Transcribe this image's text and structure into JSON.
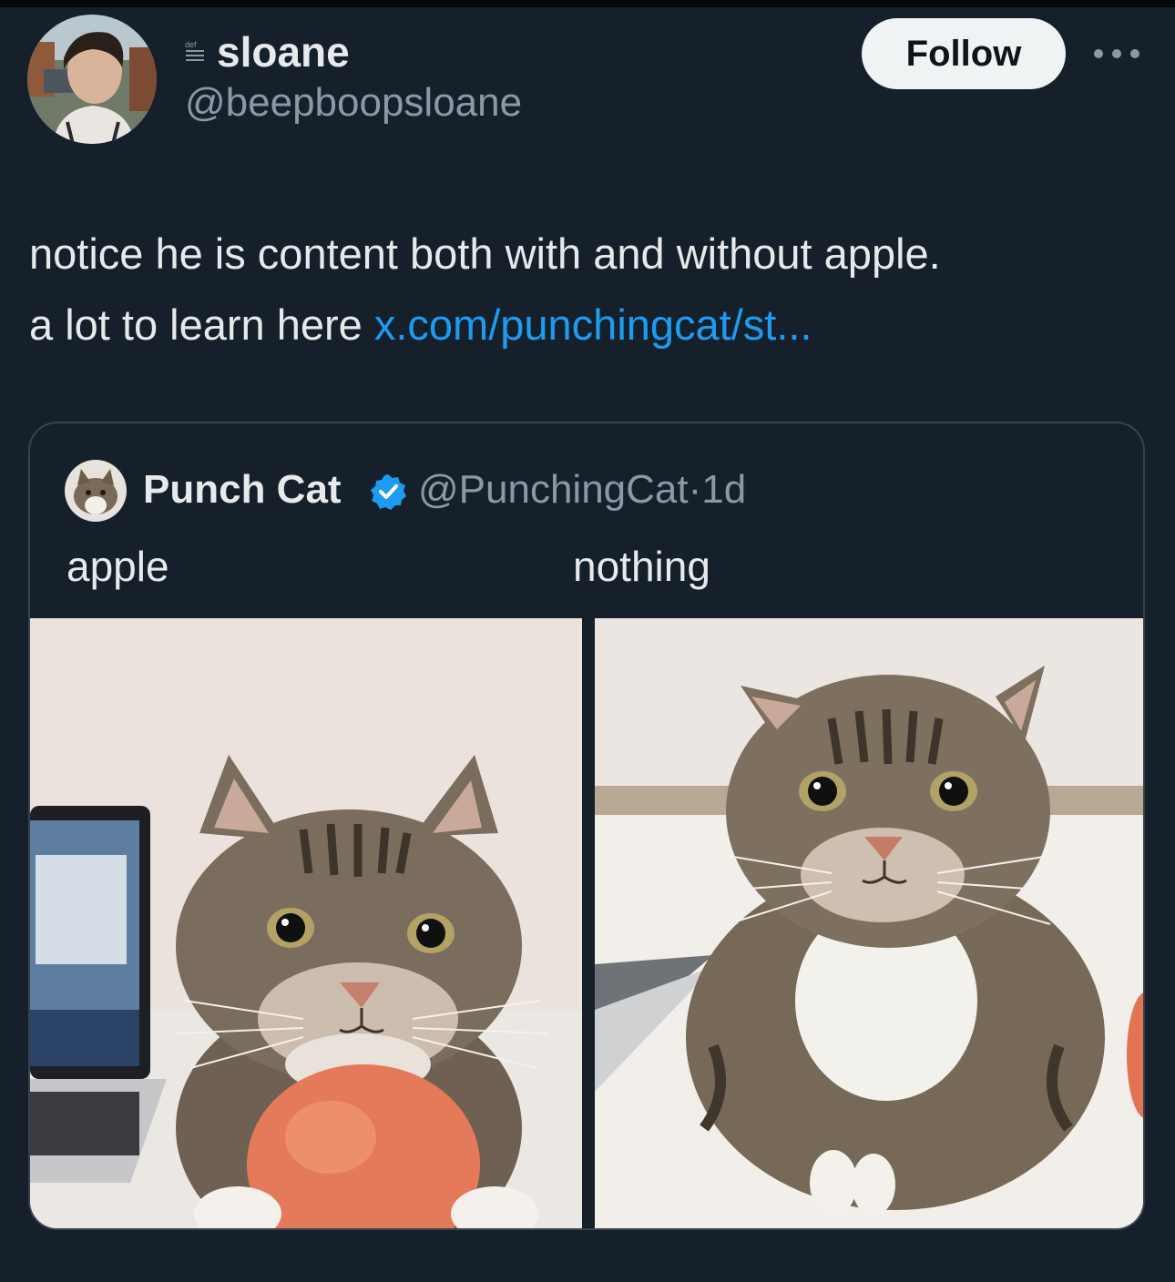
{
  "author": {
    "display_name": "sloane",
    "badge_text": "def",
    "handle": "@beepboopsloane",
    "avatar_icon": "user-avatar-photo"
  },
  "actions": {
    "follow_label": "Follow",
    "more_icon": "more-horizontal-icon"
  },
  "tweet": {
    "text_line1": "notice he is content both with and without apple.",
    "text_line2_prefix": "a lot to learn here ",
    "link_text": "x.com/punchingcat/st..."
  },
  "quote": {
    "display_name": "Punch Cat",
    "handle": "@PunchingCat",
    "separator": "·",
    "time": "1d",
    "verified_icon": "verified-badge-icon",
    "caption_left": "apple",
    "caption_right": "nothing",
    "photos": [
      {
        "description_icon": "cat-with-apple-photo"
      },
      {
        "description_icon": "cat-without-apple-photo"
      }
    ]
  },
  "colors": {
    "background": "#15202b",
    "text_primary": "#e7e9ea",
    "text_secondary": "#8b98a5",
    "link": "#1d9bf0",
    "border": "#38444d",
    "verified": "#1d9bf0"
  }
}
